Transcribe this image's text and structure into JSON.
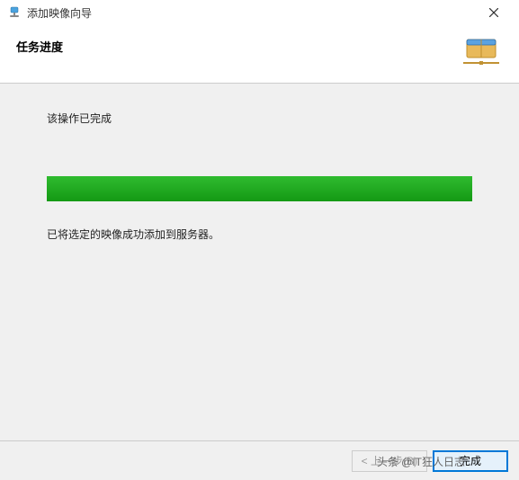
{
  "window": {
    "title": "添加映像向导"
  },
  "header": {
    "subtitle": "任务进度"
  },
  "content": {
    "status": "该操作已完成",
    "result": "已将选定的映像成功添加到服务器。",
    "progress_percent": 100
  },
  "footer": {
    "back_label": "< 上一步(B)",
    "finish_label": "完成",
    "extra_label": "头条 @IT狂人日志"
  },
  "colors": {
    "progress": "#1aaa1a",
    "primary_border": "#0078d7"
  }
}
